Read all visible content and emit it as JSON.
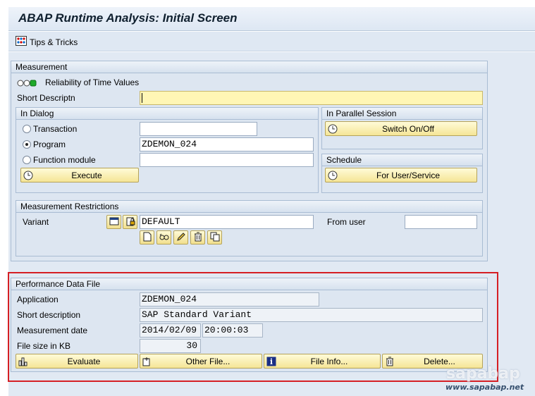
{
  "window": {
    "title": "ABAP Runtime Analysis: Initial Screen"
  },
  "toolbar": {
    "tips_label": "Tips & Tricks",
    "tips_icon": "tips-tricks-icon"
  },
  "measurement": {
    "group_title": "Measurement",
    "reliability_label": "Reliability of Time Values",
    "short_descr_label": "Short Descriptn",
    "short_descr_value": "",
    "in_dialog": {
      "group_title": "In Dialog",
      "transaction_label": "Transaction",
      "transaction_value": "",
      "program_label": "Program",
      "program_value": "ZDEMON_024",
      "function_module_label": "Function module",
      "function_module_value": "",
      "selected": "program",
      "execute_label": "Execute"
    },
    "parallel": {
      "group_title": "In Parallel Session",
      "switch_label": "Switch On/Off"
    },
    "schedule": {
      "group_title": "Schedule",
      "for_user_label": "For User/Service"
    },
    "restrictions": {
      "group_title": "Measurement Restrictions",
      "variant_label": "Variant",
      "variant_value": "DEFAULT",
      "from_user_label": "From user",
      "from_user_value": ""
    }
  },
  "performance_file": {
    "group_title": "Performance Data File",
    "application_label": "Application",
    "application_value": "ZDEMON_024",
    "short_description_label": "Short description",
    "short_description_value": "SAP Standard Variant",
    "measurement_date_label": "Measurement date",
    "measurement_date_value": "2014/02/09",
    "measurement_time_value": "20:00:03",
    "file_size_label": "File size in KB",
    "file_size_value": "30",
    "buttons": {
      "evaluate": "Evaluate",
      "other_file": "Other File...",
      "file_info": "File Info...",
      "delete": "Delete..."
    }
  },
  "watermark": {
    "logo_text": "sapabap",
    "url_text": "www.sapabap.net"
  },
  "colors": {
    "highlight": "#d51f24",
    "button_bg": "#f5e596",
    "panel_bg": "#dde6f1"
  }
}
